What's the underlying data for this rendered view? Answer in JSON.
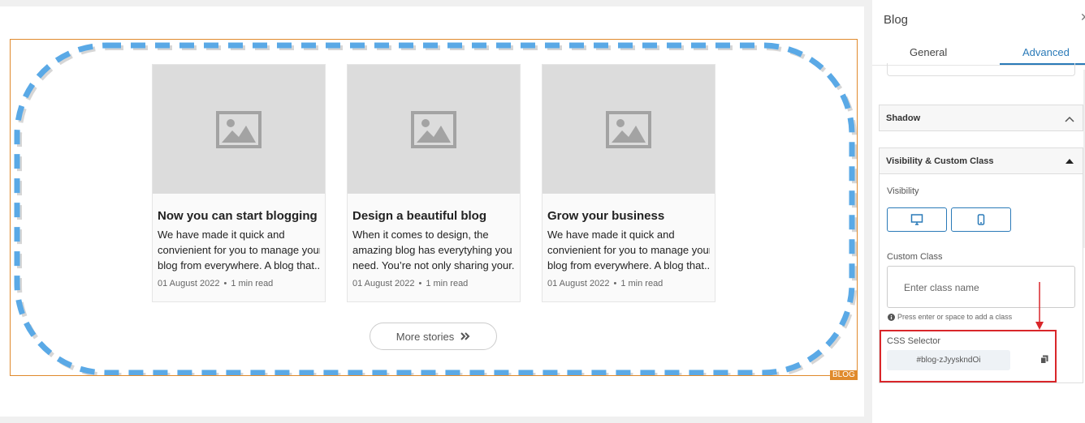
{
  "canvas": {
    "element_badge": "BLOG",
    "posts": [
      {
        "title": "Now you can start blogging",
        "excerpt_lines": [
          "We have made it quick and",
          "convienient for you to manage your",
          "blog from everywhere. A blog that.."
        ],
        "date": "01 August 2022",
        "read_time": "1 min read"
      },
      {
        "title": "Design a beautiful blog",
        "excerpt_lines": [
          "When it comes to design, the",
          "amazing blog has everytyhing you",
          "need. You’re not only sharing your.."
        ],
        "date": "01 August 2022",
        "read_time": "1 min read"
      },
      {
        "title": "Grow your business",
        "excerpt_lines": [
          "We have made it quick and",
          "convienient for you to manage your",
          "blog from everywhere. A blog that.."
        ],
        "date": "01 August 2022",
        "read_time": "1 min read"
      }
    ],
    "more_button": {
      "label": "More stories",
      "icon": "double-chevron-right-icon"
    },
    "meta_separator": "•"
  },
  "panel": {
    "title": "Blog",
    "close_icon": "close-icon",
    "tabs": [
      {
        "label": "General",
        "active": false
      },
      {
        "label": "Advanced",
        "active": true
      }
    ],
    "sections": {
      "shadow": {
        "label": "Shadow",
        "expanded": false
      },
      "visibility": {
        "label": "Visibility & Custom Class",
        "expanded": true,
        "visibility_label": "Visibility",
        "devices": [
          "desktop-icon",
          "mobile-icon"
        ],
        "custom_class_label": "Custom Class",
        "custom_class_placeholder": "Enter class name",
        "hint": "Press enter or space to add a class",
        "css_selector_label": "CSS Selector",
        "css_selector_value": "#blog-zJyyskndOi"
      }
    }
  },
  "colors": {
    "accent": "#2a7ab8",
    "dash_border": "#5aa9e6",
    "element_outline": "#e08a2c",
    "highlight": "#d9262a"
  }
}
